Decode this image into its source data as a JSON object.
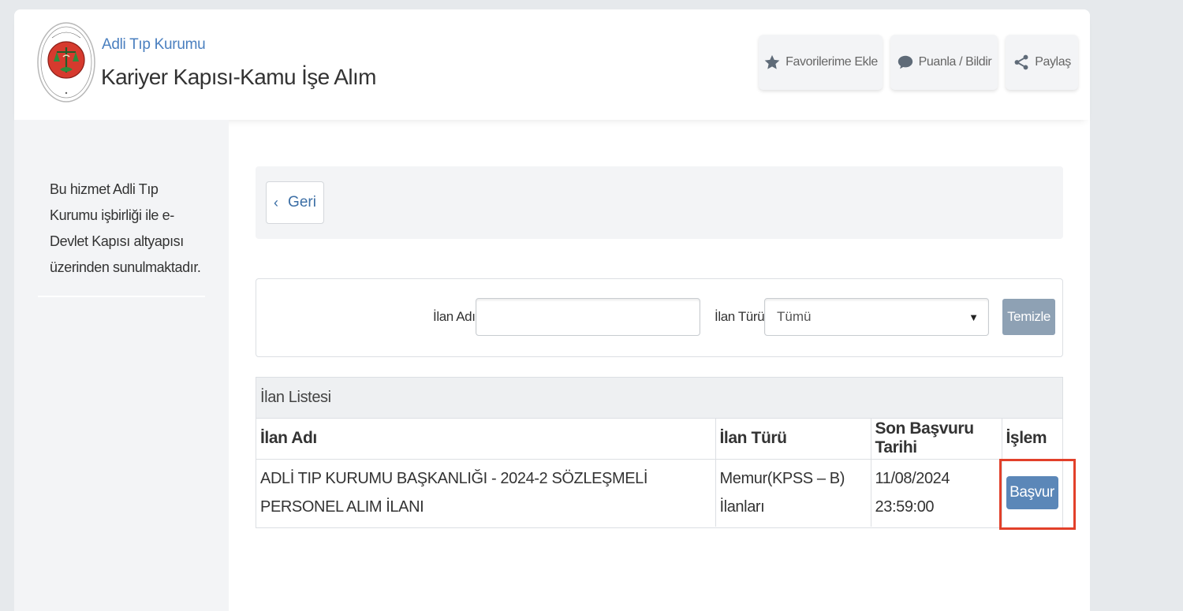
{
  "header": {
    "org_name": "Adli Tıp Kurumu",
    "service_title": "Kariyer Kapısı-Kamu İşe Alım",
    "actions": {
      "favorite_label": "Favorilerime Ekle",
      "rate_label": "Puanla / Bildir",
      "share_label": "Paylaş"
    }
  },
  "sidebar": {
    "description": "Bu hizmet Adli Tıp Kurumu işbirliği ile e-Devlet Kapısı altyapısı üzerinden sunulmaktadır."
  },
  "toolbar": {
    "back_label": "Geri"
  },
  "filter": {
    "name_label": "İlan Adı",
    "name_value": "",
    "type_label": "İlan Türü",
    "type_selected": "Tümü",
    "clear_label": "Temizle"
  },
  "listing": {
    "title": "İlan Listesi",
    "columns": [
      "İlan Adı",
      "İlan Türü",
      "Son Başvuru Tarihi",
      "İşlem"
    ],
    "rows": [
      {
        "name": "ADLİ TIP KURUMU BAŞKANLIĞI - 2024-2 SÖZLEŞMELİ PERSONEL ALIM İLANI",
        "type": "Memur(KPSS – B) İlanları",
        "deadline": "11/08/2024 23:59:00",
        "action_label": "Başvur"
      }
    ]
  },
  "colors": {
    "accent": "#5b87b8",
    "highlight_border": "#e2402a",
    "org_name": "#4a7fbf"
  }
}
